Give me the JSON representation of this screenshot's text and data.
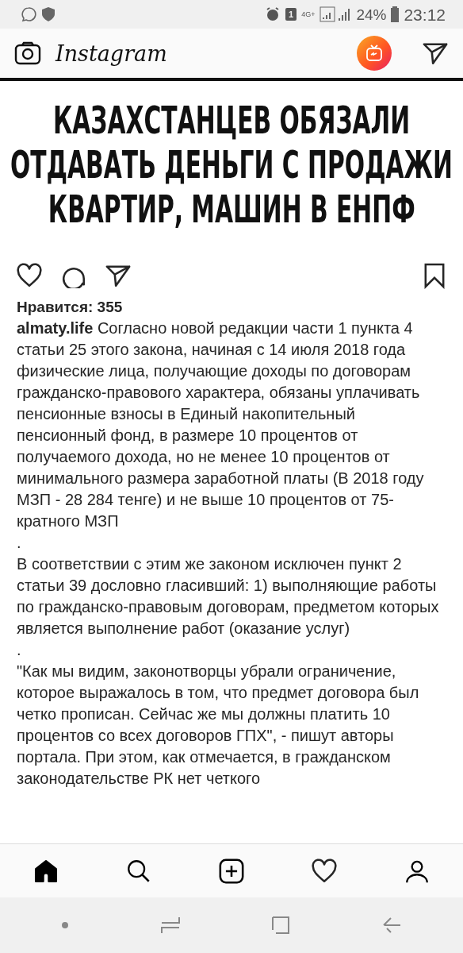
{
  "status_bar": {
    "sim_label": "1",
    "network": "4G+",
    "battery": "24%",
    "time": "23:12"
  },
  "header": {
    "logo": "Instagram"
  },
  "post": {
    "headline": [
      "КАЗАХСТАНЦЕВ ОБЯЗАЛИ",
      "ОТДАВАТЬ ДЕНЬГИ С ПРОДАЖИ",
      "КВАРТИР, МАШИН В ЕНПФ"
    ],
    "liked": false,
    "saved": false,
    "likes": "Нравится: 355",
    "caption": [
      {
        "kind": "lead",
        "username": "almaty.life",
        "text": "Согласно новой редакции части 1 пункта 4 статьи 25 этого закона, начиная с 14 июля 2018 года физические лица, получающие доходы по договорам гражданско-правового характера, обязаны уплачивать пенсионные взносы в Единый накопительный пенсионный фонд, в размере 10 процентов от получаемого дохода, но не менее 10 процентов от минимального размера заработной платы (В 2018 году МЗП - 28 284 тенге) и не выше 10 процентов от 75-кратного МЗП"
      },
      {
        "kind": "plain",
        "text": "."
      },
      {
        "kind": "plain",
        "text": "В соответствии с этим же законом исключен пункт 2 статьи 39 дословно гласивший: 1) выполняющие работы по гражданско-правовым договорам, предметом которых является выполнение работ (оказание услуг)"
      },
      {
        "kind": "plain",
        "text": "."
      },
      {
        "kind": "plain",
        "text": "\"Как мы видим, законотворцы убрали ограничение, которое выражалось в том, что предмет договора был четко прописан. Сейчас же мы должны платить 10 процентов со всех договоров ГПХ\", - пишут авторы портала. При этом, как отмечается, в гражданском законодательстве РК нет четкого"
      }
    ]
  },
  "bottom_nav": [
    {
      "kind": "home",
      "selected": true
    },
    {
      "kind": "search",
      "selected": false
    },
    {
      "kind": "add",
      "selected": false
    },
    {
      "kind": "activity",
      "selected": false
    },
    {
      "kind": "profile",
      "selected": false
    }
  ]
}
